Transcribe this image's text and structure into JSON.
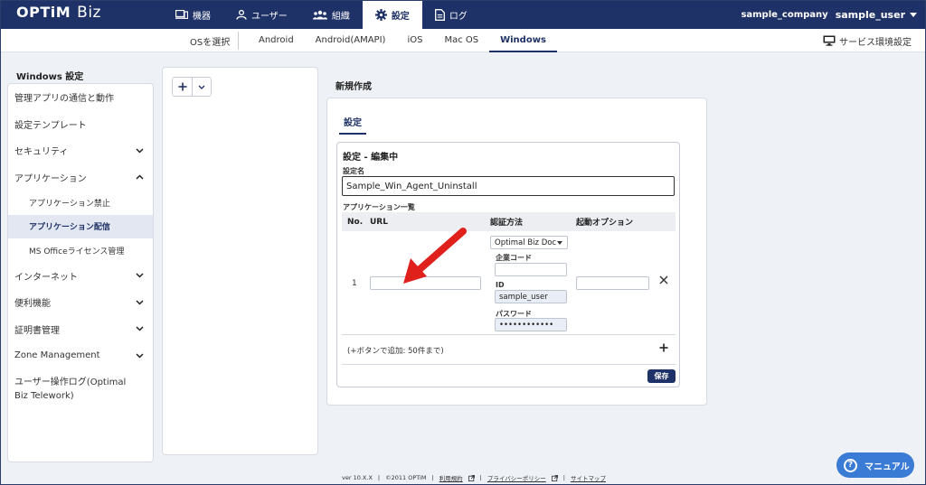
{
  "app": {
    "brand": "OPTiM",
    "product": "Biz"
  },
  "nav": [
    {
      "label": "機器",
      "icon": "devices-icon"
    },
    {
      "label": "ユーザー",
      "icon": "user-icon"
    },
    {
      "label": "組織",
      "icon": "organization-icon"
    },
    {
      "label": "設定",
      "icon": "gear-icon"
    },
    {
      "label": "ログ",
      "icon": "log-document-icon"
    }
  ],
  "account": {
    "company": "sample_company",
    "user": "sample_user"
  },
  "os_bar": {
    "select_label": "OSを選択",
    "tabs": [
      "Android",
      "Android(AMAPI)",
      "iOS",
      "Mac OS",
      "Windows"
    ],
    "active": "Windows",
    "service_settings": "サービス環境設定"
  },
  "sidebar": {
    "title": "Windows 設定",
    "items": [
      {
        "label": "管理アプリの通信と動作"
      },
      {
        "label": "設定テンプレート"
      },
      {
        "label": "セキュリティ"
      },
      {
        "label": "アプリケーション"
      },
      {
        "label": "アプリケーション禁止"
      },
      {
        "label": "アプリケーション配信"
      },
      {
        "label": "MS Officeライセンス管理"
      },
      {
        "label": "インターネット"
      },
      {
        "label": "便利機能"
      },
      {
        "label": "証明書管理"
      },
      {
        "label": "Zone Management"
      },
      {
        "label": "ユーザー操作ログ(Optimal Biz Telework)"
      }
    ]
  },
  "main": {
    "new_title": "新規作成",
    "tab": "設定",
    "edit_title": "設定 - 編集中",
    "name_label": "設定名",
    "name_value": "Sample_Win_Agent_Uninstall",
    "app_list_label": "アプリケーション一覧",
    "columns": {
      "no": "No.",
      "url": "URL",
      "auth": "認証方法",
      "launch": "起動オプション"
    },
    "row": {
      "no": "1",
      "auth_method": "Optimal Biz Doc",
      "company_code_label": "企業コード",
      "id_label": "ID",
      "id_value": "sample_user",
      "password_label": "パスワード",
      "password_value": "••••••••••••"
    },
    "add_hint": "(+ボタンで追加: 50件まで)",
    "save_label": "保存"
  },
  "footer": {
    "version": "ver 10.X.X",
    "copyright": "©2011 OPTiM",
    "terms": "利用規約",
    "privacy": "プライバシーポリシー",
    "sitemap": "サイトマップ"
  },
  "manual_button": "マニュアル",
  "colors": {
    "navy": "#1f3267",
    "arrow": "#e0201b",
    "manual": "#3a7bd5"
  }
}
